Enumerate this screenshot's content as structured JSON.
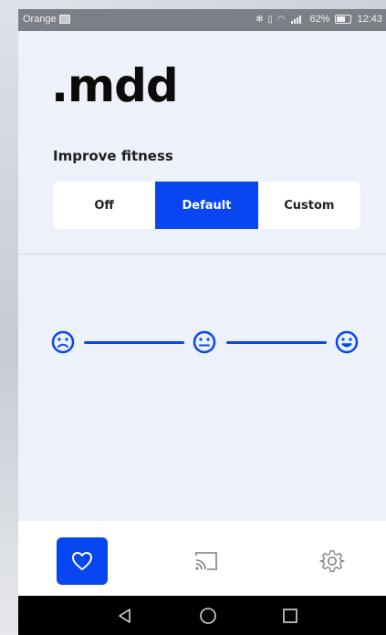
{
  "statusbar": {
    "carrier": "Orange",
    "icons": "✻ ▯ ◠",
    "battery_percent": "62%",
    "time": "12:43"
  },
  "app": {
    "logo": ".mdd"
  },
  "fitness": {
    "label": "Improve fitness",
    "options": [
      "Off",
      "Default",
      "Custom"
    ],
    "selected": "Default"
  },
  "scale": {
    "faces": [
      "sad-face-icon",
      "neutral-face-icon",
      "happy-face-icon"
    ]
  },
  "bottom_nav": {
    "items": [
      "heart-icon",
      "cast-icon",
      "gear-icon"
    ],
    "active": "heart-icon"
  },
  "system_nav": {
    "buttons": [
      "back-triangle-icon",
      "home-circle-icon",
      "recents-square-icon"
    ]
  },
  "colors": {
    "accent": "#0846f2",
    "background": "#edf1fa",
    "statusbar": "#7b7f86",
    "nav": "#ffffff"
  }
}
